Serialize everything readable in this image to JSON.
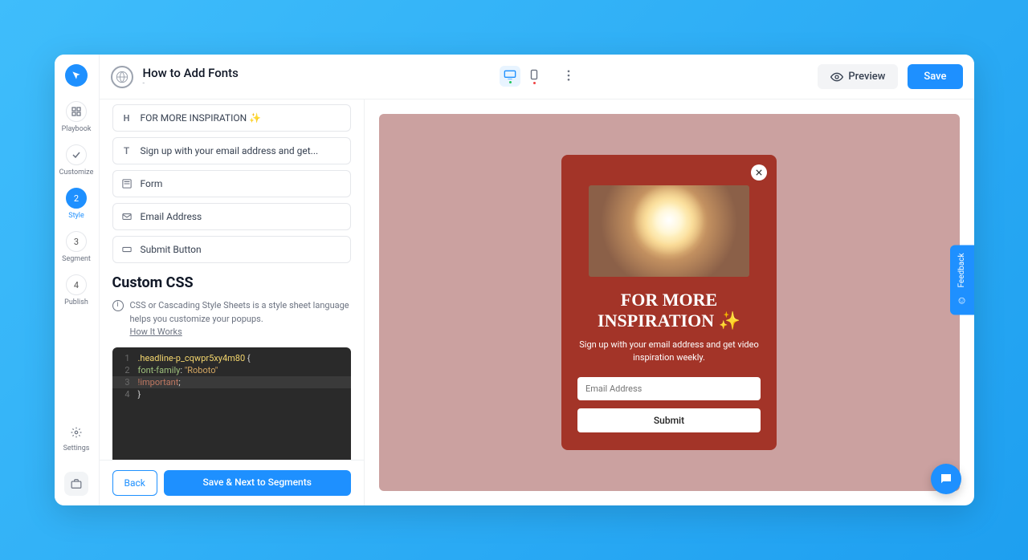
{
  "header": {
    "title": "How to Add Fonts",
    "subtitle": "-",
    "preview_label": "Preview",
    "save_label": "Save"
  },
  "nav": {
    "items": [
      {
        "label": "Playbook",
        "icon": "grid"
      },
      {
        "label": "Customize",
        "icon": "check"
      },
      {
        "label": "Style",
        "icon": "num2",
        "active": true
      },
      {
        "label": "Segment",
        "icon": "num3"
      },
      {
        "label": "Publish",
        "icon": "num4"
      }
    ],
    "settings_label": "Settings"
  },
  "panel": {
    "elements": [
      {
        "icon": "H",
        "label": "FOR MORE INSPIRATION ✨"
      },
      {
        "icon": "T",
        "label": "Sign up with your email address and get..."
      },
      {
        "icon": "form",
        "label": "Form"
      },
      {
        "icon": "mail",
        "label": "Email Address"
      },
      {
        "icon": "button",
        "label": "Submit Button"
      }
    ],
    "section_title": "Custom CSS",
    "info_text": "CSS or Cascading Style Sheets is a style sheet language helps you customize your popups.",
    "how_link": "How It Works",
    "code_lines": [
      {
        "n": "1",
        "parts": [
          {
            "cls": "c-selector",
            "t": ".headline-p_cqwpr5xy4m80"
          },
          {
            "cls": "c-brace",
            "t": " {"
          }
        ]
      },
      {
        "n": "2",
        "parts": [
          {
            "cls": "c-prop",
            "t": "font-family"
          },
          {
            "cls": "c-brace",
            "t": ": "
          },
          {
            "cls": "c-val",
            "t": "\"Roboto\""
          }
        ]
      },
      {
        "n": "3",
        "parts": [
          {
            "cls": "c-imp",
            "t": "!important"
          },
          {
            "cls": "c-brace",
            "t": ";"
          }
        ],
        "hl": true
      },
      {
        "n": "4",
        "parts": [
          {
            "cls": "c-brace",
            "t": "}"
          }
        ]
      }
    ],
    "back_label": "Back",
    "next_label": "Save & Next to Segments"
  },
  "popup": {
    "title": "FOR MORE INSPIRATION ✨",
    "desc": "Sign up with your email address and get video inspiration weekly.",
    "email_placeholder": "Email Address",
    "submit_label": "Submit"
  },
  "feedback": {
    "label": "Feedback"
  }
}
